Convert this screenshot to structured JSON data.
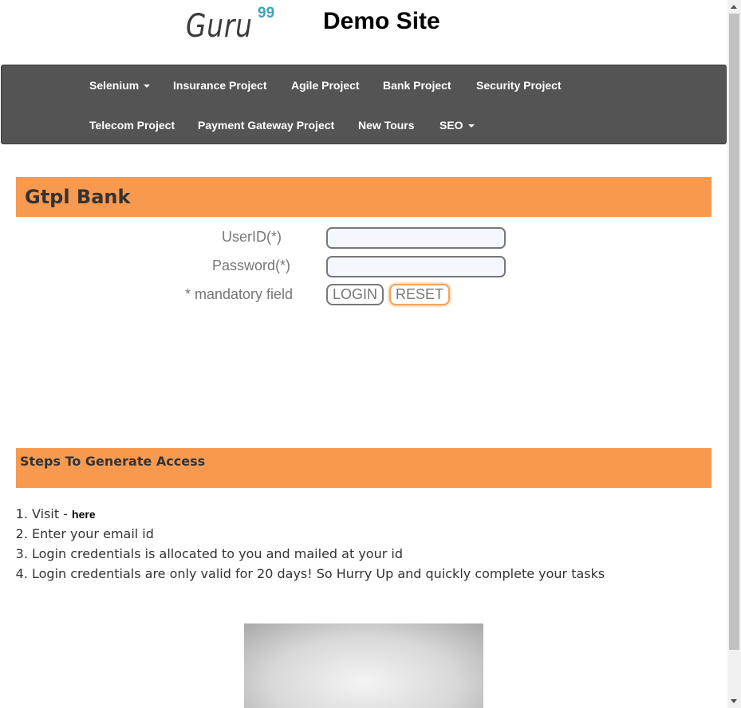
{
  "header": {
    "logo_text": "Guru",
    "logo_sup": "99",
    "site_title": "Demo Site"
  },
  "nav": {
    "row1": [
      {
        "label": "Selenium",
        "dropdown": true
      },
      {
        "label": "Insurance Project",
        "dropdown": false
      },
      {
        "label": "Agile Project",
        "dropdown": false
      },
      {
        "label": "Bank Project",
        "dropdown": false
      },
      {
        "label": "Security Project",
        "dropdown": false
      }
    ],
    "row2": [
      {
        "label": "Telecom Project",
        "dropdown": false
      },
      {
        "label": "Payment Gateway Project",
        "dropdown": false
      },
      {
        "label": "New Tours",
        "dropdown": false
      },
      {
        "label": "SEO",
        "dropdown": true
      }
    ]
  },
  "bank": {
    "title": "Gtpl Bank"
  },
  "login_form": {
    "userid_label": "UserID(*)",
    "userid_value": "",
    "password_label": "Password(*)",
    "password_value": "",
    "mandatory_note": "* mandatory field",
    "login_button": "LOGIN",
    "reset_button": "RESET"
  },
  "steps": {
    "title": "Steps To Generate Access",
    "step1_prefix": "Visit - ",
    "step1_link": "here",
    "step2": "Enter your email id",
    "step3": "Login credentials is allocated to you and mailed at your id",
    "step4": "Login credentials are only valid for 20 days! So Hurry Up and quickly complete your tasks"
  },
  "colors": {
    "banner": "#f79a50",
    "navbar": "#545454",
    "logo_accent": "#3fa3b8"
  }
}
